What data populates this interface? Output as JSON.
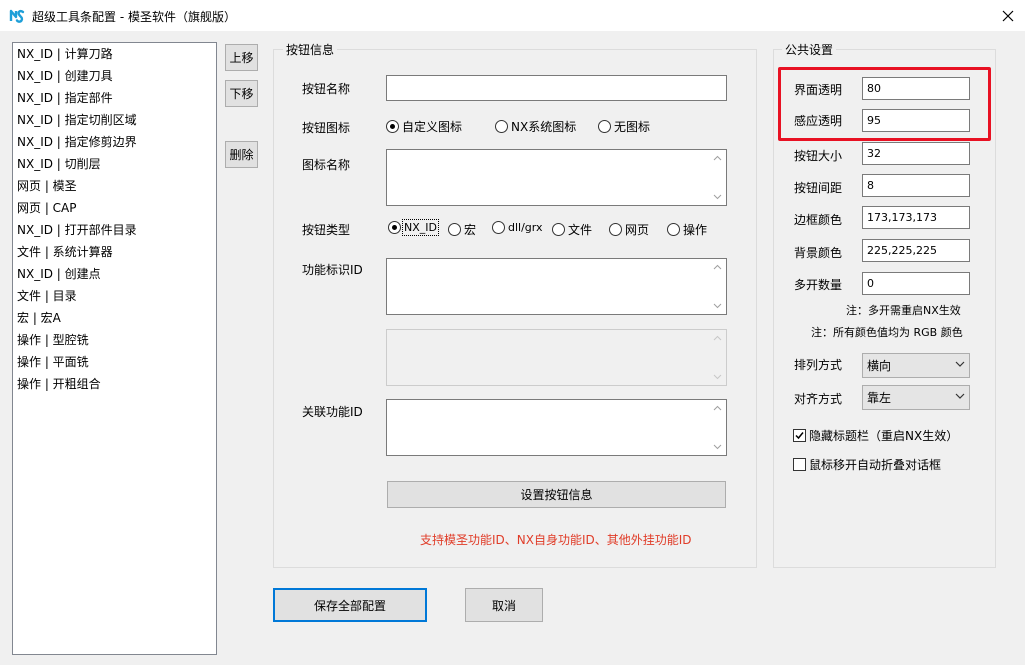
{
  "window": {
    "title": "超级工具条配置 - 模圣软件（旗舰版）",
    "close_glyph": "✕"
  },
  "list": {
    "items": [
      "NX_ID | 计算刀路",
      "NX_ID | 创建刀具",
      "NX_ID | 指定部件",
      "NX_ID | 指定切削区域",
      "NX_ID | 指定修剪边界",
      "NX_ID | 切削层",
      "网页 | 模圣",
      "网页 | CAP",
      "NX_ID | 打开部件目录",
      "文件 | 系统计算器",
      "NX_ID | 创建点",
      "文件 | 目录",
      "宏 | 宏A",
      "操作 | 型腔铣",
      "操作 | 平面铣",
      "操作 | 开粗组合"
    ]
  },
  "side_buttons": {
    "move_up": "上移",
    "move_down": "下移",
    "delete": "删除"
  },
  "button_info": {
    "group_title": "按钮信息",
    "name_label": "按钮名称",
    "name_value": "",
    "icon_label": "按钮图标",
    "icon_options": [
      "自定义图标",
      "NX系统图标",
      "无图标"
    ],
    "icon_selected": "自定义图标",
    "icon_name_label": "图标名称",
    "type_label": "按钮类型",
    "type_options": [
      "NX_ID",
      "宏",
      "dll/grx",
      "文件",
      "网页",
      "操作"
    ],
    "type_selected": "NX_ID",
    "func_id_label": "功能标识ID",
    "related_func_label": "关联功能ID",
    "set_button": "设置按钮信息",
    "note": "支持模圣功能ID、NX自身功能ID、其他外挂功能ID"
  },
  "public_settings": {
    "group_title": "公共设置",
    "interface_opacity_label": "界面透明",
    "interface_opacity_value": "80",
    "sensing_opacity_label": "感应透明",
    "sensing_opacity_value": "95",
    "button_size_label": "按钮大小",
    "button_size_value": "32",
    "button_spacing_label": "按钮间距",
    "button_spacing_value": "8",
    "border_color_label": "边框颜色",
    "border_color_value": "173,173,173",
    "bg_color_label": "背景颜色",
    "bg_color_value": "225,225,225",
    "multi_count_label": "多开数量",
    "multi_count_value": "0",
    "note1": "注：多开需重启NX生效",
    "note2": "注：所有颜色值均为 RGB 颜色",
    "arrange_label": "排列方式",
    "arrange_value": "横向",
    "align_label": "对齐方式",
    "align_value": "靠左",
    "hide_titlebar_label": "隐藏标题栏（重启NX生效）",
    "hide_titlebar_checked": true,
    "auto_collapse_label": "鼠标移开自动折叠对话框",
    "auto_collapse_checked": false
  },
  "footer": {
    "save_all": "保存全部配置",
    "cancel": "取消"
  },
  "colors": {
    "highlight": "#e81123",
    "note_red": "#e03c28",
    "focus_blue": "#0078d7",
    "app_icon": "#1e9fd8"
  }
}
